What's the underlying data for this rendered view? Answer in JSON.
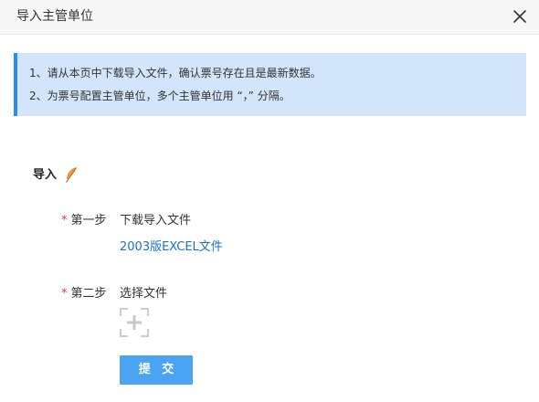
{
  "dialog": {
    "title": "导入主管单位"
  },
  "notice": {
    "line1": "1、请从本页中下载导入文件，确认票号存在且是最新数据。",
    "line2": "2、为票号配置主管单位，多个主管单位用 “，” 分隔。"
  },
  "import_section": {
    "title": "导入"
  },
  "step1": {
    "required_mark": "*",
    "label": "第一步",
    "text": "下载导入文件",
    "link_text": "2003版EXCEL文件"
  },
  "step2": {
    "required_mark": "*",
    "label": "第二步",
    "text": "选择文件"
  },
  "submit": {
    "label": "提 交"
  },
  "colors": {
    "accent": "#2d8cf0",
    "notice_bg": "#d2e5fb",
    "link": "#1a73c8",
    "button": "#4ba3f4",
    "required": "#e4393c",
    "feather": "#e8832a"
  },
  "icons": {
    "close": "close-icon",
    "feather": "feather-icon",
    "upload": "plus-icon"
  }
}
